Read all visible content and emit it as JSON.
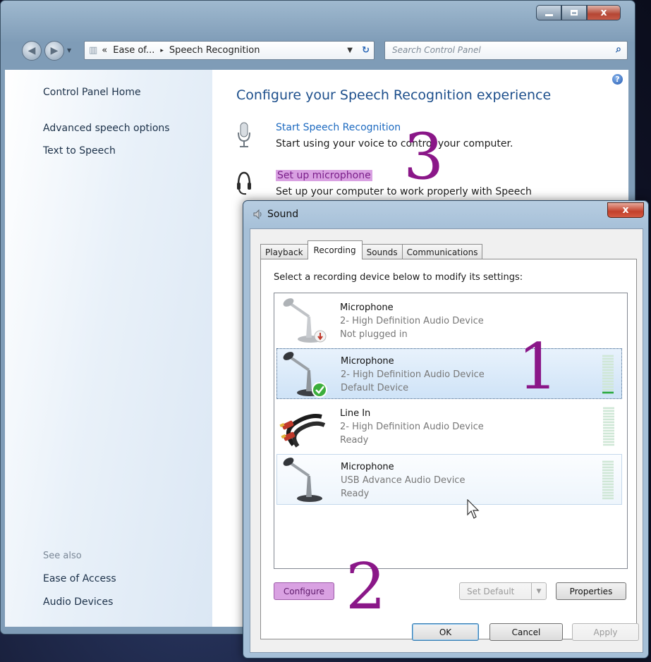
{
  "colors": {
    "accent_highlight": "#d9a1e2",
    "annotation": "#8a1788",
    "link": "#1d6ac0"
  },
  "window": {
    "minimize_icon": "minimize-icon",
    "maximize_icon": "maximize-icon",
    "close_label": "x"
  },
  "navbar": {
    "breadcrumb": {
      "prefix": "«",
      "segment1": "Ease of...",
      "separator": "▸",
      "segment2": "Speech Recognition"
    },
    "search_placeholder": "Search Control Panel"
  },
  "sidebar": {
    "home": "Control Panel Home",
    "items": [
      "Advanced speech options",
      "Text to Speech"
    ],
    "see_also_title": "See also",
    "see_also": [
      "Ease of Access",
      "Audio Devices"
    ]
  },
  "main": {
    "heading": "Configure your Speech Recognition experience",
    "tasks": [
      {
        "link": "Start Speech Recognition",
        "desc": "Start using your voice to control your computer."
      },
      {
        "link": "Set up microphone",
        "desc": "Set up your computer to work properly with Speech"
      }
    ]
  },
  "dialog": {
    "title": "Sound",
    "close_label": "x",
    "tabs": [
      "Playback",
      "Recording",
      "Sounds",
      "Communications"
    ],
    "active_tab": "Recording",
    "instructions": "Select a recording device below to modify its settings:",
    "devices": [
      {
        "name": "Microphone",
        "sub": "2- High Definition Audio Device",
        "status": "Not plugged in",
        "icon": "microphone-unplugged-icon",
        "level": 0
      },
      {
        "name": "Microphone",
        "sub": "2- High Definition Audio Device",
        "status": "Default Device",
        "icon": "microphone-default-icon",
        "level": 0.1
      },
      {
        "name": "Line In",
        "sub": "2- High Definition Audio Device",
        "status": "Ready",
        "icon": "line-in-cable-icon",
        "level": 0
      },
      {
        "name": "Microphone",
        "sub": "USB Advance Audio Device",
        "status": "Ready",
        "icon": "microphone-icon",
        "level": 0
      }
    ],
    "buttons": {
      "configure": "Configure",
      "set_default": "Set Default",
      "properties": "Properties",
      "ok": "OK",
      "cancel": "Cancel",
      "apply": "Apply"
    }
  },
  "annotations": [
    "1",
    "2",
    "3"
  ]
}
